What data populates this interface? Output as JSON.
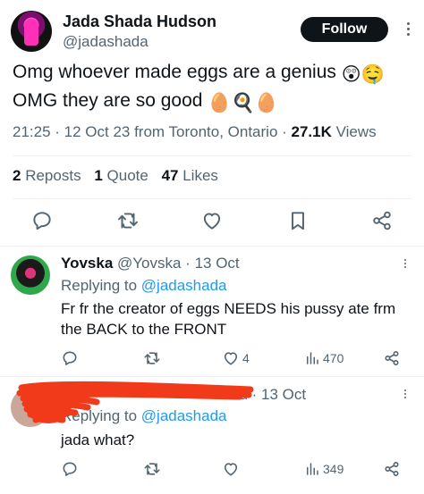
{
  "main_tweet": {
    "author": {
      "name": "Jada Shada Hudson",
      "handle": "@jadashada"
    },
    "follow_label": "Follow",
    "text_line1": "Omg whoever made eggs are a genius",
    "text_line1_emoji": "😲🤤",
    "text_line2": "OMG they are so good",
    "text_line2_emoji": "🥚🍳🥚",
    "meta_text": "21:25 · 12 Oct 23 from Toronto, Ontario · ",
    "views_count": "27.1K",
    "views_label": " Views",
    "stats": {
      "reposts_count": "2",
      "reposts_label": "Reposts",
      "quotes_count": "1",
      "quotes_label": "Quote",
      "likes_count": "47",
      "likes_label": "Likes"
    }
  },
  "replies": [
    {
      "name": "Yovska",
      "handle_date": "@Yovska · 13 Oct",
      "replying_label": "Replying to ",
      "replying_mention": "@jadashada",
      "text": "Fr fr the creator of eggs NEEDS his pussy ate frm the BACK to the FRONT",
      "likes": "4",
      "views": "470"
    },
    {
      "name": "",
      "handle_date": "1d · 13 Oct",
      "replying_label": "Replying to ",
      "replying_mention": "@jadashada",
      "text": "jada what?",
      "likes": "",
      "views": "349"
    }
  ],
  "icons": [
    "more-icon",
    "reply-icon",
    "repost-icon",
    "like-icon",
    "bookmark-icon",
    "share-icon",
    "views-icon"
  ],
  "colors": {
    "text": "#0f1419",
    "secondary": "#536471",
    "link": "#1d9bf0",
    "follow_bg": "#0f1419",
    "scribble": "#f03a1a"
  }
}
